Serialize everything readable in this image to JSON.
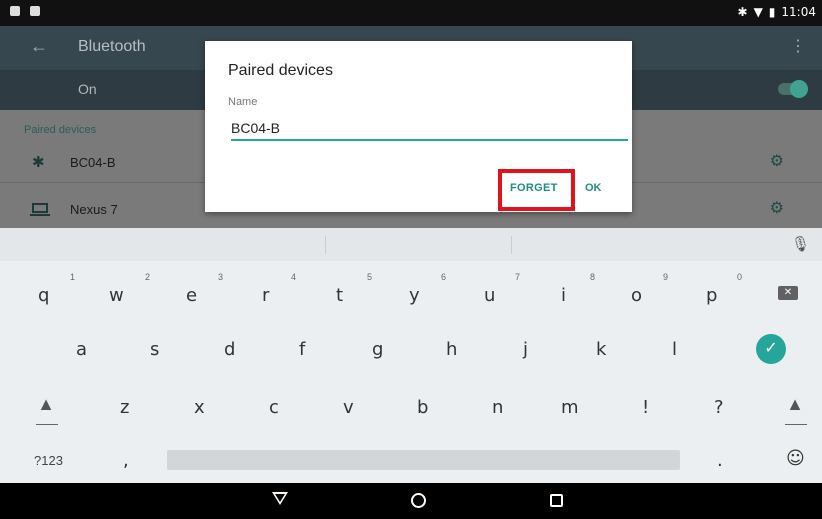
{
  "status_bar": {
    "time": "11:04"
  },
  "toolbar": {
    "title": "Bluetooth",
    "toggle_label": "On"
  },
  "settings": {
    "section_header": "Paired devices",
    "devices": [
      {
        "name": "BC04-B",
        "icon": "bluetooth-icon"
      },
      {
        "name": "Nexus 7",
        "icon": "laptop-icon"
      }
    ]
  },
  "dialog": {
    "title": "Paired devices",
    "field_label": "Name",
    "field_value": "BC04-B",
    "forget_label": "FORGET",
    "ok_label": "OK",
    "highlight_color": "#e0121b",
    "accent_color": "#1b8f84"
  },
  "keyboard": {
    "row1": [
      {
        "key": "q",
        "num": "1"
      },
      {
        "key": "w",
        "num": "2"
      },
      {
        "key": "e",
        "num": "3"
      },
      {
        "key": "r",
        "num": "4"
      },
      {
        "key": "t",
        "num": "5"
      },
      {
        "key": "y",
        "num": "6"
      },
      {
        "key": "u",
        "num": "7"
      },
      {
        "key": "i",
        "num": "8"
      },
      {
        "key": "o",
        "num": "9"
      },
      {
        "key": "p",
        "num": "0"
      }
    ],
    "row2": [
      "a",
      "s",
      "d",
      "f",
      "g",
      "h",
      "j",
      "k",
      "l"
    ],
    "row3": [
      "z",
      "x",
      "c",
      "v",
      "b",
      "n",
      "m",
      "!",
      "?"
    ],
    "symbols_label": "?123",
    "comma": ",",
    "period": ".",
    "emoji": "☺"
  }
}
